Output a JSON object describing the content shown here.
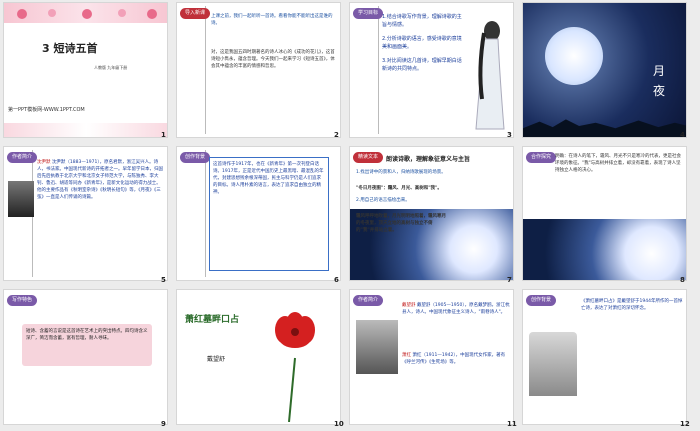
{
  "colors": {
    "accent": "#7a5aa8",
    "red": "#c0303a",
    "night": "#0e1f45",
    "pink": "#f6d4dc"
  },
  "slides": [
    {
      "num": "1",
      "title": "3 短诗五首",
      "edition": "人教版 九年级下册",
      "footer": "第一PPT模板网-WWW.1PPT.COM"
    },
    {
      "num": "2",
      "tag": "导入新课",
      "p1": "上课之前，我们一起听听一首诗。看看你能不能听出这是谁的诗。",
      "p2": "对，这是我国五四时期著名的诗人冰心的《成功的花儿》，这首诗短小隽永，蕴含哲理。今天我们一起来学习《短诗五首》，体会其中蕴含的丰富的情感和哲思。"
    },
    {
      "num": "3",
      "tag": "学习目标",
      "goals": [
        "1.结合诗歌写作背景，理解诗歌的主旨与情感。",
        "2.分析诗歌的语言，感受诗歌的意境美和画面美。",
        "3.对比阅读这几首诗，理解早期白话新诗的共同特点。"
      ]
    },
    {
      "num": "4",
      "title": "月夜"
    },
    {
      "num": "5",
      "tag": "作者简介",
      "name": "沈尹默",
      "bio": "沈尹默（1883—1971），原名君默，浙江吴兴人。诗人，书法家。中国现代新诗的开拓者之一。早年留学日本，归国后先后执教于北京大学和北京女子师范大学，与陈独秀、李大钊、鲁迅、胡适等同办《新青年》，是新文化运动的得力战士。他的主要作品有《秋明室杂诗》《秋明长短句》等，《月夜》《三弦》一直是人们传诵的诗篇。"
    },
    {
      "num": "6",
      "tag": "创作背景",
      "text": "这首诗作于1917年，也在《新青年》第一次刊登白话诗。1917年，正是近代中国历史上最黑暗、最混乱的年代，封建思想残余根深蒂固，民主与科学仍是人们追求的目标。诗人用朴素的语言，表达了追求自由独立的精神。"
    },
    {
      "num": "7",
      "tag": "精读文本",
      "heading": "朗读诗歌，理解象征意义与主旨",
      "q1": "1.找出诗中的景和人，归纳诗歌展现的场景。",
      "a1": "\"冬日月夜图\"：霜风、月光、高树和\"我\"。",
      "q2": "2.用自己的语言描绘出来。",
      "a2": "霜风呼呼地吹着，月光明明地照着，霜风寒月的冬夜里，顶天立地的高树与独立不倚的\"我\"并排站立着。"
    },
    {
      "num": "8",
      "tag": "合作探究",
      "text": "明确：在诗人的笔下，霜风、月光不只是寒冷的代表，更是社会环境的象征。\"我\"与高树并排立着，却没有靠着，表现了诗人坚持独立人格的决心。"
    },
    {
      "num": "9",
      "tag": "写作特色",
      "text": "短诗、含蓄的言说是这首诗在艺术上的突出特点。四句诗含义深广，简洁而含蓄，富有哲理，耐人寻味。"
    },
    {
      "num": "10",
      "title": "萧红墓畔口占",
      "author": "戴望舒"
    },
    {
      "num": "11",
      "tag": "作者简介",
      "name1": "戴望舒",
      "bio1": "戴望舒（1905—1950），原名戴梦鸥，浙江杭县人，诗人。中国现代象征主义诗人，\"雨巷诗人\"。",
      "name2": "萧红",
      "bio2": "萧红（1911—1942），中国现代女作家，著有《呼兰河传》《生死场》等。"
    },
    {
      "num": "12",
      "tag": "创作背景",
      "text": "《萧红墓畔口占》是戴望舒于1944年所作的一首悼亡诗，表达了对萧红的深切怀念。"
    }
  ]
}
